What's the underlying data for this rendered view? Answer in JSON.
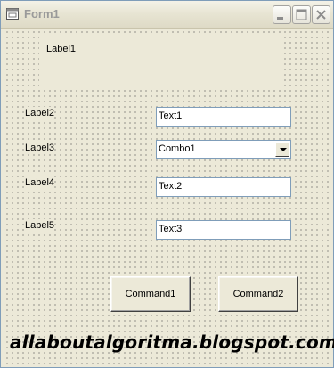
{
  "window": {
    "title": "Form1"
  },
  "labels": {
    "label1": "Label1",
    "label2": "Label2",
    "label3": "Label3",
    "label4": "Label4",
    "label5": "Label5"
  },
  "inputs": {
    "text1": "Text1",
    "combo1": "Combo1",
    "text2": "Text2",
    "text3": "Text3"
  },
  "buttons": {
    "command1": "Command1",
    "command2": "Command2"
  },
  "watermark": "allaboutalgoritma.blogspot.com"
}
